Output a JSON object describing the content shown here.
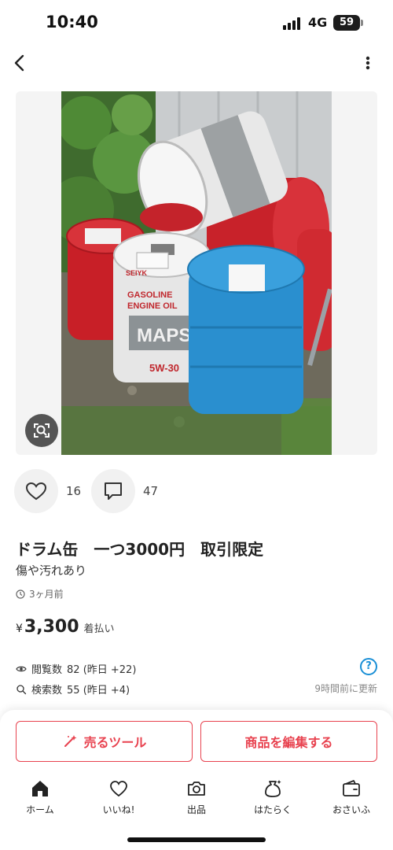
{
  "status_bar": {
    "time": "10:40",
    "network": "4G",
    "battery": "59"
  },
  "item": {
    "title": "ドラム缶　一つ3000円　取引限定",
    "description": "傷や汚れあり",
    "posted": "3ヶ月前",
    "price_currency": "¥",
    "price_amount": "3,300",
    "shipping": "着払い",
    "likes_count": "16",
    "comments_count": "47"
  },
  "photo_labels": {
    "brand": "MAPS",
    "product_line1": "GASOLINE",
    "product_line2": "ENGINE OIL",
    "grade": "5W-30",
    "maker": "SEIYK"
  },
  "stats": {
    "views_label": "閲覧数",
    "views_value": "82 (昨日 +22)",
    "searches_label": "検索数",
    "searches_value": "55 (昨日 +4)",
    "updated": "9時間前に更新",
    "help": "?"
  },
  "actions": {
    "sell_tool": "売るツール",
    "edit_item": "商品を編集する"
  },
  "tabs": [
    {
      "label": "ホーム",
      "icon": "home-icon"
    },
    {
      "label": "いいね!",
      "icon": "heart-icon"
    },
    {
      "label": "出品",
      "icon": "camera-icon"
    },
    {
      "label": "はたらく",
      "icon": "bag-icon"
    },
    {
      "label": "おさいふ",
      "icon": "wallet-icon"
    }
  ],
  "colors": {
    "accent": "#e8424f",
    "info": "#1a8fd6",
    "drum_red": "#d8262c",
    "drum_blue": "#2a8fcf",
    "drum_white": "#eeeeee"
  }
}
